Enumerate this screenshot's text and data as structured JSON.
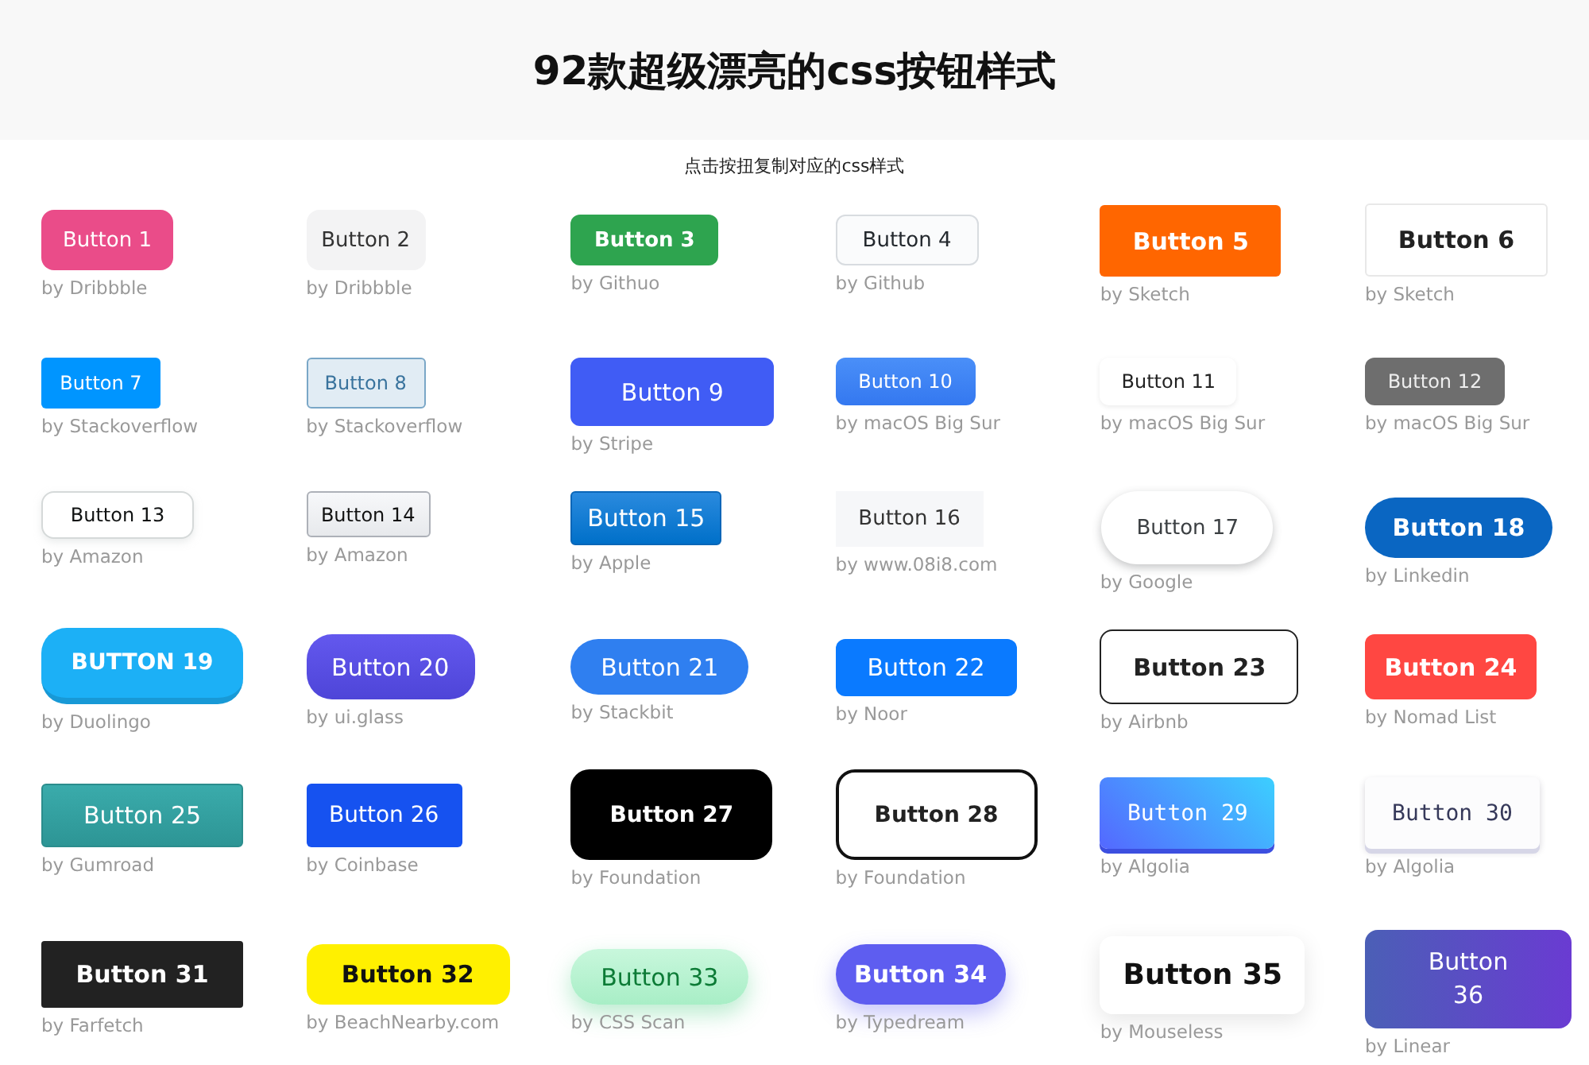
{
  "header": {
    "title": "92款超级漂亮的css按钮样式"
  },
  "subtitle": "点击按扭复制对应的css样式",
  "buttons": [
    {
      "label": "Button 1",
      "author": "by Dribbble"
    },
    {
      "label": "Button 2",
      "author": "by Dribbble"
    },
    {
      "label": "Button 3",
      "author": "by Githuo"
    },
    {
      "label": "Button 4",
      "author": "by Github"
    },
    {
      "label": "Button 5",
      "author": "by Sketch"
    },
    {
      "label": "Button 6",
      "author": "by Sketch"
    },
    {
      "label": "Button 7",
      "author": "by Stackoverflow"
    },
    {
      "label": "Button 8",
      "author": "by Stackoverflow"
    },
    {
      "label": "Button 9",
      "author": "by Stripe"
    },
    {
      "label": "Button 10",
      "author": "by macOS Big Sur"
    },
    {
      "label": "Button 11",
      "author": "by macOS Big Sur"
    },
    {
      "label": "Button 12",
      "author": "by macOS Big Sur"
    },
    {
      "label": "Button 13",
      "author": "by Amazon"
    },
    {
      "label": "Button 14",
      "author": "by Amazon"
    },
    {
      "label": "Button 15",
      "author": "by Apple"
    },
    {
      "label": "Button 16",
      "author": "by www.08i8.com"
    },
    {
      "label": "Button 17",
      "author": "by Google"
    },
    {
      "label": "Button 18",
      "author": "by Linkedin"
    },
    {
      "label": "BUTTON 19",
      "author": "by Duolingo"
    },
    {
      "label": "Button 20",
      "author": "by ui.glass"
    },
    {
      "label": "Button 21",
      "author": "by Stackbit"
    },
    {
      "label": "Button 22",
      "author": "by Noor"
    },
    {
      "label": "Button 23",
      "author": "by Airbnb"
    },
    {
      "label": "Button 24",
      "author": "by Nomad List"
    },
    {
      "label": "Button 25",
      "author": "by Gumroad"
    },
    {
      "label": "Button 26",
      "author": "by Coinbase"
    },
    {
      "label": "Button 27",
      "author": "by Foundation"
    },
    {
      "label": "Button 28",
      "author": "by Foundation"
    },
    {
      "label": "Button 29",
      "author": "by Algolia"
    },
    {
      "label": "Button 30",
      "author": "by Algolia"
    },
    {
      "label": "Button 31",
      "author": "by Farfetch"
    },
    {
      "label": "Button 32",
      "author": "by BeachNearby.com"
    },
    {
      "label": "Button 33",
      "author": "by CSS Scan"
    },
    {
      "label": "Button 34",
      "author": "by Typedream"
    },
    {
      "label": "Button 35",
      "author": "by Mouseless"
    },
    {
      "label": "Button 36",
      "author": "by Linear"
    }
  ]
}
